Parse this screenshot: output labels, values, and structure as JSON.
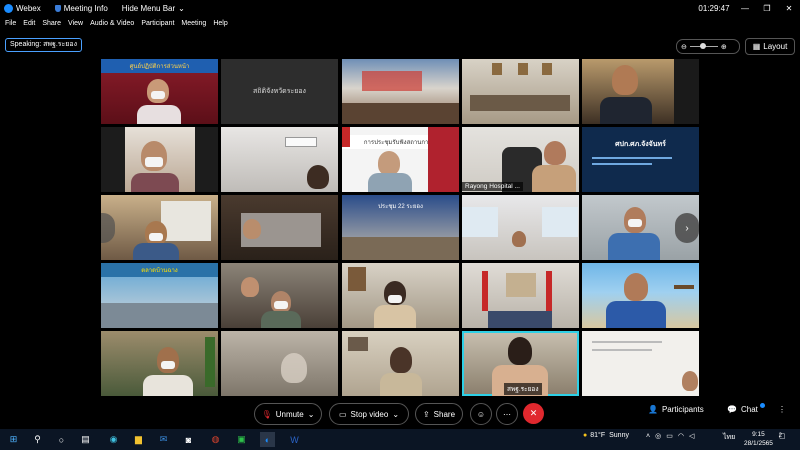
{
  "titlebar": {
    "app_name": "Webex",
    "meeting_info": "Meeting Info",
    "hide_menu": "Hide Menu Bar",
    "chevron": "⌄",
    "time": "01:29:47"
  },
  "menu": [
    "File",
    "Edit",
    "Share",
    "View",
    "Audio & Video",
    "Participant",
    "Meeting",
    "Help"
  ],
  "speaking": "Speaking: สพฐ.ระยอง",
  "layout_label": "Layout",
  "tiles": {
    "t0_0": {
      "banner": "ศูนย์ปฏิบัติการส่วนหน้า"
    },
    "t0_1": {
      "text": "สถิติจังหวัดระยอง"
    },
    "t1_2": {
      "banner": "การประชุมรับฟังสถานการณ์"
    },
    "t1_3": {
      "label": "Rayong Hospital ..."
    },
    "t1_4": {
      "banner": "ศปก.ศภ.จังจันทร์"
    },
    "t2_2": {
      "banner": "ประชุม 22 ระยอง"
    },
    "t3_0": {
      "banner": "ตลาดบ้านฉาง"
    },
    "t4_3": {
      "label": "สพฐ.ระยอง"
    }
  },
  "controls": {
    "unmute": "Unmute",
    "stop_video": "Stop video",
    "share": "Share",
    "participants": "Participants",
    "chat": "Chat"
  },
  "taskbar": {
    "weather_temp": "81°F",
    "weather_text": "Sunny",
    "lang": "ไทย",
    "clock_time": "9:15",
    "clock_date": "28/1/2565",
    "notif_count": "2"
  }
}
